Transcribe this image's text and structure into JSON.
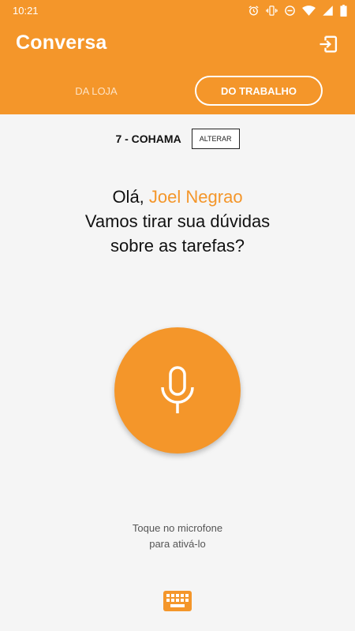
{
  "status_bar": {
    "time": "10:21",
    "icons": [
      "alarm-icon",
      "vibrate-icon",
      "do-not-disturb-icon",
      "wifi-icon",
      "signal-icon",
      "battery-icon"
    ]
  },
  "app_bar": {
    "title": "Conversa",
    "logout_icon": "logout-icon",
    "tabs": [
      {
        "label": "DA LOJA",
        "selected": false
      },
      {
        "label": "DO TRABALHO",
        "selected": true
      }
    ]
  },
  "store": {
    "name": "7 - COHAMA",
    "change_label": "ALTERAR"
  },
  "greeting": {
    "prefix": "Olá,",
    "user_name": "Joel Negrao",
    "line2": "Vamos tirar sua dúvidas",
    "line3": "sobre as tarefas?"
  },
  "mic": {
    "icon": "microphone-icon",
    "hint_line1": "Toque no microfone",
    "hint_line2": "para ativá-lo"
  },
  "keyboard": {
    "icon": "keyboard-icon"
  },
  "colors": {
    "accent": "#f4962a",
    "background": "#f5f5f5",
    "text": "#111111"
  }
}
